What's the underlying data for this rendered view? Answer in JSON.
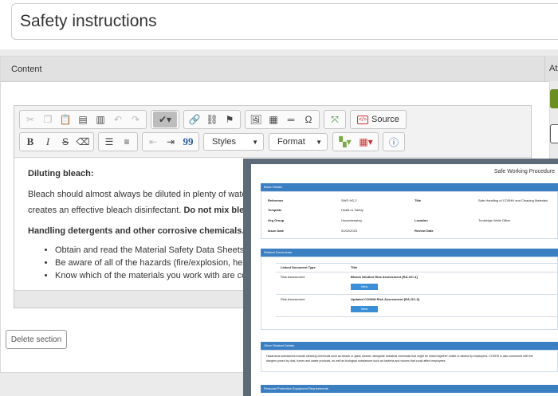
{
  "title_field": {
    "value": "Safety instructions"
  },
  "panel": {
    "header": "Content",
    "side_header": "At"
  },
  "toolbar": {
    "source_label": "Source",
    "styles_label": "Styles",
    "format_label": "Format",
    "bold": "B",
    "italic": "I",
    "strike": "S",
    "quote": "99",
    "omega": "Ω"
  },
  "editor_content": {
    "heading1": "Diluting bleach:",
    "para1_line1": "Bleach should almost always be diluted in plenty of wate",
    "para1_line2_a": "creates an effective bleach disinfectant. ",
    "para1_line2_b": "Do not mix blea",
    "heading2": "Handling detergents and other corrosive chemicals.",
    "bullets": [
      "Obtain and read the Material Safety Data Sheets",
      "Be aware of all of the hazards (fire/explosion, hea",
      "Know which of the materials you work with are co"
    ]
  },
  "delete_section": "Delete section",
  "preview": {
    "title": "Safe Working Procedure",
    "basic_details_label": "Basic Details",
    "fields": {
      "reference_label": "Reference",
      "reference_value": "SWP-HS-2",
      "title_label": "Title",
      "title_value": "Safe Handling of COSHH and Cleaning Materials",
      "template_label": "Template",
      "template_value": "Health & Safety",
      "org_group_label": "Org Group",
      "org_group_value": "Housekeeping",
      "location_label": "Location",
      "location_value": "Tunbridge Wells Office",
      "issue_date_label": "Issue Date",
      "issue_date_value": "01/02/2023",
      "review_date_label": "Review Date"
    },
    "related_docs_label": "Related Documents",
    "related_docs_columns": [
      "Linked Document Type",
      "Title"
    ],
    "related_docs_rows": [
      {
        "type": "Risk Assessment",
        "title": "Bleach Dilution Risk Assessment [RA-GC-4]",
        "button": "View"
      },
      {
        "type": "Risk Assessment",
        "title": "Updated COSHH Risk Assessment [RA-GC-3]",
        "button": "View"
      }
    ],
    "other_details_label": "Other Related Details",
    "other_details_line1": "Hazardous substances include cleaning chemicals such as bleach or glass cleaner, alongside industrial chemicals that might be mixed together onsite or diluted by employees. COSHH is also concerned with the",
    "other_details_line2": "dangers posed by dust, fumes and waste products, as well as biological substances such as bacteria and viruses that could affect employees.",
    "ppe_label": "Personal Protective Equipment Requirements"
  }
}
